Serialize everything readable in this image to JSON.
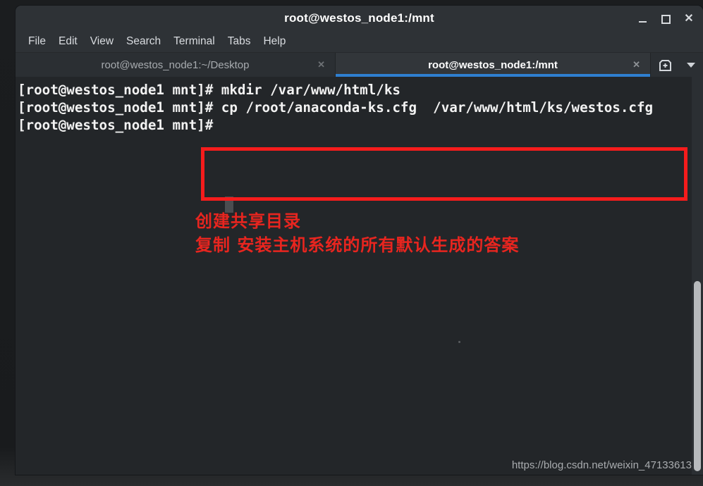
{
  "window": {
    "title": "root@westos_node1:/mnt",
    "controls": {
      "minimize": "–",
      "maximize": "□",
      "close": "✕"
    }
  },
  "menubar": {
    "items": [
      {
        "label": "File"
      },
      {
        "label": "Edit"
      },
      {
        "label": "View"
      },
      {
        "label": "Search"
      },
      {
        "label": "Terminal"
      },
      {
        "label": "Tabs"
      },
      {
        "label": "Help"
      }
    ]
  },
  "tabbar": {
    "tabs": [
      {
        "label": "root@westos_node1:~/Desktop",
        "close": "✕",
        "active": false
      },
      {
        "label": "root@westos_node1:/mnt",
        "close": "✕",
        "active": true
      }
    ],
    "new_tab_icon": "new-tab-icon",
    "tab_list_icon": "chevron-down-icon"
  },
  "terminal": {
    "prompt": "[root@westos_node1 mnt]#",
    "lines": [
      "[root@westos_node1 mnt]# mkdir /var/www/html/ks",
      "[root@westos_node1 mnt]# cp /root/anaconda-ks.cfg  /var/www/html/ks/westos.cfg",
      "[root@westos_node1 mnt]#"
    ],
    "content": "[root@westos_node1 mnt]# mkdir /var/www/html/ks\n[root@westos_node1 mnt]# cp /root/anaconda-ks.cfg  /var/www/html/ks/westos.cfg\n[root@westos_node1 mnt]#",
    "commands": [
      {
        "command": "mkdir",
        "args": "/var/www/html/ks"
      },
      {
        "command": "cp",
        "args": "/root/anaconda-ks.cfg  /var/www/html/ks/westos.cfg"
      }
    ]
  },
  "annotations": {
    "line1": "创建共享目录",
    "line2": "复制 安装主机系统的所有默认生成的答案",
    "highlight_color": "#f51c1c",
    "text_color": "#e8251f"
  },
  "watermark": {
    "text": "https://blog.csdn.net/weixin_47133613"
  },
  "colors": {
    "titlebar": "#2e3236",
    "terminal_bg": "#232629",
    "tab_active_underline": "#2f7fd0",
    "terminal_text": "#f2f2f2",
    "scrollbar_thumb": "#b7babd"
  }
}
